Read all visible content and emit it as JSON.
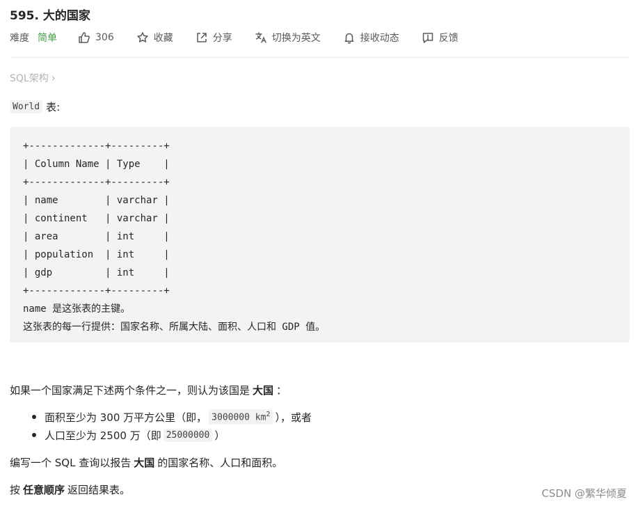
{
  "problem": {
    "title": "595. 大的国家",
    "difficulty_label": "难度",
    "difficulty": "简单",
    "likes": "306",
    "favorite_label": "收藏",
    "share_label": "分享",
    "switch_lang_label": "切换为英文",
    "subscribe_label": "接收动态",
    "feedback_label": "反馈"
  },
  "breadcrumb": {
    "label": "SQL架构",
    "chevron": "›"
  },
  "intro": {
    "table_name": "World",
    "suffix": "表:"
  },
  "schema_block": {
    "lines": [
      "+-------------+---------+",
      "| Column Name | Type    |",
      "+-------------+---------+",
      "| name        | varchar |",
      "| continent   | varchar |",
      "| area        | int     |",
      "| population  | int     |",
      "| gdp         | int     |",
      "+-------------+---------+",
      "name 是这张表的主键。",
      "这张表的每一行提供：国家名称、所属大陆、面积、人口和 GDP 值。"
    ]
  },
  "condition_intro": {
    "prefix": "如果一个国家满足下述两个条件之一，则认为该国是",
    "bold": "大国",
    "suffix": "："
  },
  "conditions": [
    {
      "prefix": "面积至少为 300 万平方公里（即，",
      "code": "3000000 km",
      "sup": "2",
      "suffix": "），或者"
    },
    {
      "prefix": "人口至少为 2500 万（即",
      "code": "25000000",
      "suffix": "）"
    }
  ],
  "task": {
    "prefix": "编写一个 SQL 查询以报告",
    "bold": "大国",
    "suffix": "的国家名称、人口和面积。"
  },
  "order": {
    "prefix": "按",
    "bold": "任意顺序",
    "suffix": "返回结果表。"
  },
  "watermark": "CSDN @繁华倾夏",
  "colors": {
    "difficulty_easy": "#43a047",
    "code_bg": "#f2f3f5",
    "muted": "#b3b3b3"
  }
}
